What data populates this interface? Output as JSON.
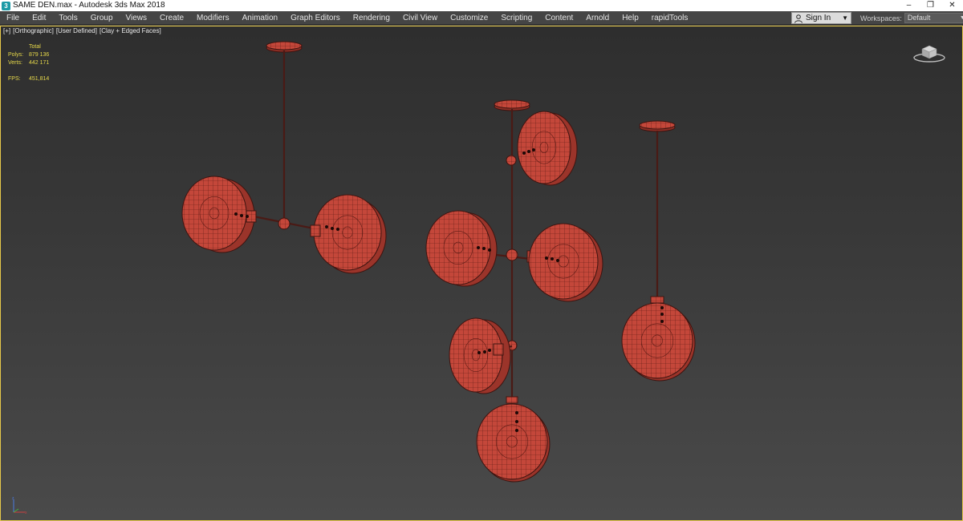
{
  "window": {
    "title": "SAME DEN.max - Autodesk 3ds Max 2018",
    "app_icon_glyph": "3"
  },
  "window_controls": {
    "minimize": "–",
    "restore": "❐",
    "close": "✕"
  },
  "menu": {
    "items": [
      {
        "label": "File"
      },
      {
        "label": "Edit"
      },
      {
        "label": "Tools"
      },
      {
        "label": "Group"
      },
      {
        "label": "Views"
      },
      {
        "label": "Create"
      },
      {
        "label": "Modifiers"
      },
      {
        "label": "Animation"
      },
      {
        "label": "Graph Editors"
      },
      {
        "label": "Rendering"
      },
      {
        "label": "Civil View"
      },
      {
        "label": "Customize"
      },
      {
        "label": "Scripting"
      },
      {
        "label": "Content"
      },
      {
        "label": "Arnold"
      },
      {
        "label": "Help"
      },
      {
        "label": "rapidTools"
      }
    ]
  },
  "signin": {
    "label": "Sign In",
    "caret": "▼"
  },
  "workspaces": {
    "label": "Workspaces:",
    "value": "Default",
    "caret": "▼"
  },
  "viewport": {
    "labels": [
      "[+]",
      "[Orthographic]",
      "[User Defined]",
      "[Clay + Edged Faces]"
    ],
    "stats": {
      "header": "Total",
      "polys_label": "Polys:",
      "polys_value": "879 136",
      "verts_label": "Verts:",
      "verts_value": "442 171",
      "fps_label": "FPS:",
      "fps_value": "451,814"
    },
    "viewcube_icon": "viewcube-icon",
    "axis_icon": "axis-tripod-icon"
  },
  "colors": {
    "titlebar": "#ffffff",
    "menubar": "#454545",
    "viewport_border": "#e6c84a",
    "stats_text": "#e6d84a",
    "model_fill": "#c0483b",
    "model_wire": "#5a1a14"
  }
}
